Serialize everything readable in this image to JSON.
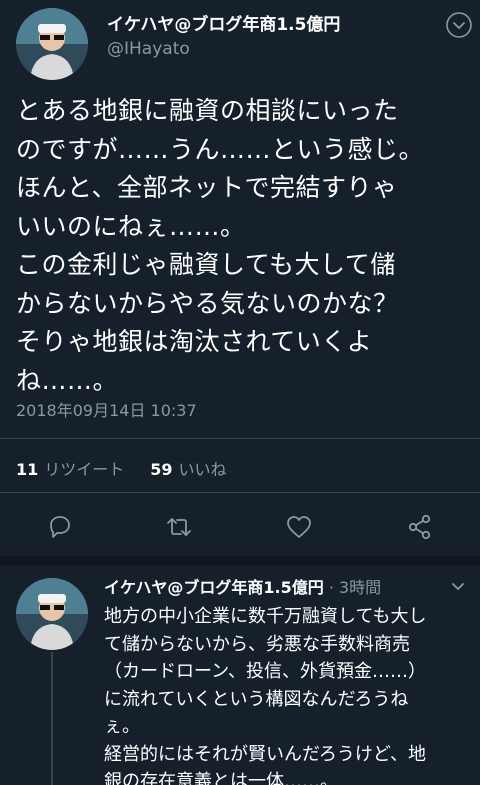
{
  "tweet": {
    "display_name": "イケハヤ@ブログ年商1.5億円",
    "handle": "@IHayato",
    "text": "とある地銀に融資の相談にいった\nのですが……うん……という感じ。\nほんと、全部ネットで完結すりゃ\nいいのにねぇ……。\nこの金利じゃ融資しても大して儲\nからないからやる気ないのかな？\nそりゃ地銀は淘汰されていくよ\nね……。",
    "timestamp": "2018年09月14日 10:37",
    "retweet_count": "11",
    "retweet_label": "リツイート",
    "like_count": "59",
    "like_label": "いいね"
  },
  "actions": {
    "reply_icon": "reply-icon",
    "retweet_icon": "retweet-icon",
    "like_icon": "heart-icon",
    "share_icon": "share-icon"
  },
  "reply": {
    "display_name": "イケハヤ@ブログ年商1.5億円",
    "meta": "· 3時間",
    "text": "地方の中小企業に数千万融資しても大し\nて儲からないから、劣悪な手数料商売\n（カードローン、投信、外貨預金……）\nに流れていくという構図なんだろうね\nぇ。\n経営的にはそれが賢いんだろうけど、地\n銀の存在意義とは一体……。"
  },
  "colors": {
    "background": "#15202b",
    "secondary_text": "#8899a6",
    "divider": "#38444d"
  }
}
